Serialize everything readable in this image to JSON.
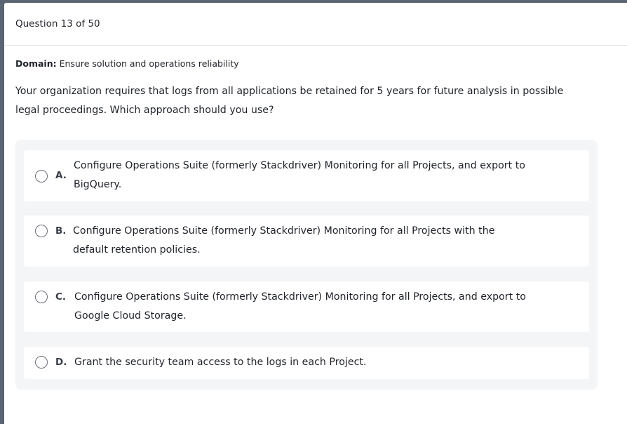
{
  "header": {
    "question_counter": "Question 13 of 50"
  },
  "domain": {
    "label": "Domain:",
    "value": "Ensure solution and operations reliability"
  },
  "question": {
    "text": "Your organization requires that logs from all applications be retained for 5 years for future analysis in possible legal proceedings. Which approach should you use?"
  },
  "options": [
    {
      "letter": "A.",
      "text": "Configure Operations Suite (formerly Stackdriver) Monitoring for all Projects, and export to BigQuery."
    },
    {
      "letter": "B.",
      "text": "Configure Operations Suite (formerly Stackdriver) Monitoring for all Projects with the default retention policies."
    },
    {
      "letter": "C.",
      "text": "Configure Operations Suite (formerly Stackdriver) Monitoring for all Projects, and export to Google Cloud Storage."
    },
    {
      "letter": "D.",
      "text": "Grant the security team access to the logs in each Project."
    }
  ]
}
